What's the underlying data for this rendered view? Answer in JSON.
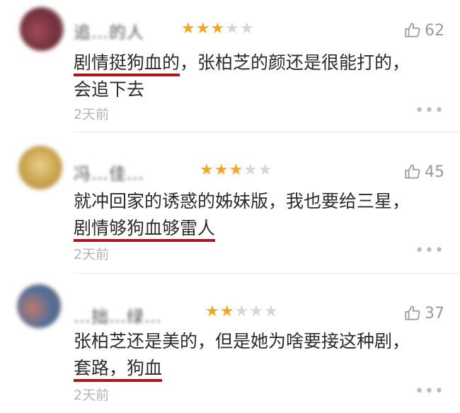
{
  "colors": {
    "star_on": "#f5a623",
    "star_off": "#d6d6d6",
    "underline": "#b0151d"
  },
  "comments": [
    {
      "username": "追…的人",
      "rating": 3,
      "rating_max": 5,
      "likes": "62",
      "text_line1_underlined": "剧情挺狗血的",
      "text_line1_rest": "，张柏芝的颜还是很能打的，",
      "text_line2": "会追下去",
      "time": "2天前",
      "more": "•••"
    },
    {
      "username": "冯…佳…",
      "rating": 3,
      "rating_max": 5,
      "likes": "45",
      "text_line1": "就冲回家的诱惑的姊妹版，我也要给三星，",
      "text_line2_underlined": "剧情够狗血够雷人",
      "time": "2天前",
      "more": "•••"
    },
    {
      "username": "…拙…绿…",
      "rating": 2,
      "rating_max": 5,
      "likes": "37",
      "text_line1": "张柏芝还是美的，但是她为啥要接这种剧，",
      "text_line2_underlined": "套路，狗血",
      "time": "2天前",
      "more": "•••"
    }
  ]
}
